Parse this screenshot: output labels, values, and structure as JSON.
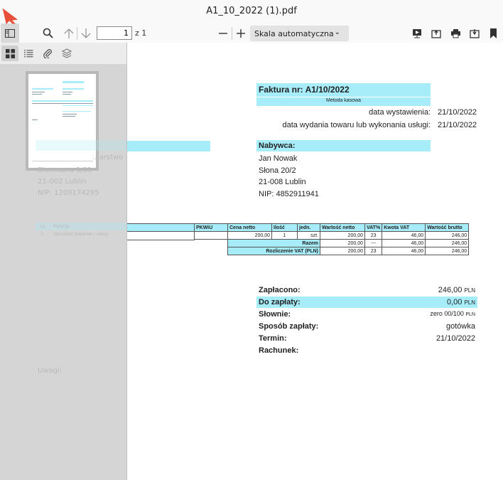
{
  "window": {
    "title": "A1_10_2022 (1).pdf"
  },
  "toolbar": {
    "page_number": "1",
    "of_pages": "z 1",
    "scale_label": "Skala automatyczna"
  },
  "sidebar_faded": {
    "seller_line1": "...arstwo",
    "seller_line2": "Słoneczna 1/91",
    "seller_line3": "21-002 Lublin",
    "seller_line4": "NIP: 1209174295",
    "col_lp": "Lp.",
    "col_pozycja": "Pozycja",
    "row_lp": "1",
    "row_pozycja": "Sprzedaż towarów / usług",
    "uwagi": "Uwagi:"
  },
  "invoice": {
    "title": "Faktura nr: A1/10/2022",
    "method": "Metoda kasowa",
    "issue_label": "data wystawienia:",
    "issue_date": "21/10/2022",
    "delivery_label": "data wydania towaru lub wykonania usługi:",
    "delivery_date": "21/10/2022",
    "buyer_header": "Nabywca:",
    "buyer_name": "Jan Nowak",
    "buyer_street": "Słona 20/2",
    "buyer_city": "21-008 Lublin",
    "buyer_nip": "NIP: 4852911941",
    "table": {
      "headers": [
        "PKWiU",
        "Cena netto",
        "Ilość",
        "jedn.",
        "Wartość netto",
        "VAT%",
        "Kwota VAT",
        "Wartość brutto"
      ],
      "row": [
        "",
        "200,00",
        "1",
        "szt.",
        "200,00",
        "23",
        "46,00",
        "246,00"
      ],
      "razem_label": "Razem",
      "razem": [
        "200,00",
        "---",
        "46,00",
        "246,00"
      ],
      "rozliczenie_label": "Rozliczenie VAT (PLN)",
      "rozliczenie": [
        "200,00",
        "23",
        "46,00",
        "246,00"
      ]
    },
    "summary": {
      "zaplacono_label": "Zapłacono:",
      "zaplacono": "246,00",
      "do_zaplaty_label": "Do zapłaty:",
      "do_zaplaty": "0,00",
      "slownie_label": "Słownie:",
      "slownie": "zero 00/100",
      "sposob_label": "Sposób zapłaty:",
      "sposob": "gotówka",
      "termin_label": "Termin:",
      "termin": "21/10/2022",
      "rachunek_label": "Rachunek:",
      "currency": "PLN"
    }
  },
  "colors": {
    "accent_cyan": "#a6ecf9",
    "cursor_red": "#e8503a"
  }
}
